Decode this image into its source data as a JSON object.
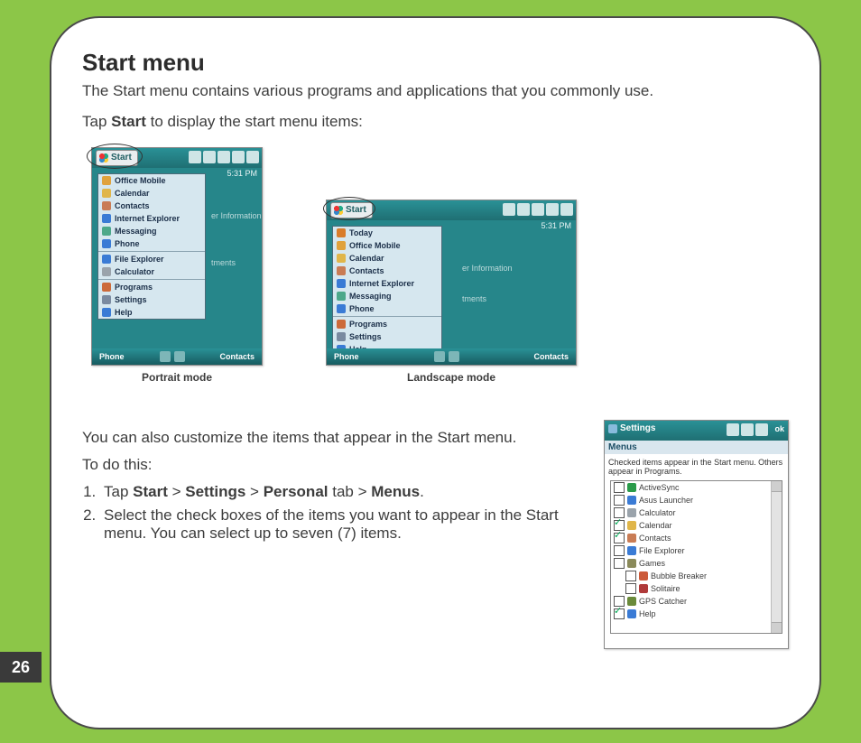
{
  "page_number": "26",
  "heading": "Start menu",
  "intro": "The Start menu contains various programs and applications that you commonly use.",
  "tap_pre": "Tap ",
  "tap_bold": "Start",
  "tap_post": " to display the start menu items:",
  "caption_portrait": "Portrait mode",
  "caption_landscape": "Landscape mode",
  "start_label": "Start",
  "clock": "5:31 PM",
  "bg1": "er Information",
  "bg2": "tments",
  "menu_portrait": [
    {
      "label": "Office Mobile",
      "color": "#e0a23c",
      "bold": true,
      "sep": false
    },
    {
      "label": "Calendar",
      "color": "#e0b64a",
      "bold": true,
      "sep": false
    },
    {
      "label": "Contacts",
      "color": "#c97c55",
      "bold": true,
      "sep": false
    },
    {
      "label": "Internet Explorer",
      "color": "#3a7bd5",
      "bold": true,
      "sep": false
    },
    {
      "label": "Messaging",
      "color": "#4ca88a",
      "bold": true,
      "sep": false
    },
    {
      "label": "Phone",
      "color": "#3a7bd5",
      "bold": true,
      "sep": true
    },
    {
      "label": "File Explorer",
      "color": "#3a7bd5",
      "bold": true,
      "sep": false
    },
    {
      "label": "Calculator",
      "color": "#9aa3ab",
      "bold": true,
      "sep": true
    },
    {
      "label": "Programs",
      "color": "#cc6a3a",
      "bold": true,
      "sep": false
    },
    {
      "label": "Settings",
      "color": "#7a8aa0",
      "bold": true,
      "sep": false
    },
    {
      "label": "Help",
      "color": "#3a7bd5",
      "bold": true,
      "sep": false
    }
  ],
  "menu_landscape": [
    {
      "label": "Today",
      "color": "#d97c2a",
      "bold": true,
      "sep": false
    },
    {
      "label": "Office Mobile",
      "color": "#e0a23c",
      "bold": true,
      "sep": false
    },
    {
      "label": "Calendar",
      "color": "#e0b64a",
      "bold": true,
      "sep": false
    },
    {
      "label": "Contacts",
      "color": "#c97c55",
      "bold": true,
      "sep": false
    },
    {
      "label": "Internet Explorer",
      "color": "#3a7bd5",
      "bold": true,
      "sep": false
    },
    {
      "label": "Messaging",
      "color": "#4ca88a",
      "bold": true,
      "sep": false
    },
    {
      "label": "Phone",
      "color": "#3a7bd5",
      "bold": true,
      "sep": true
    },
    {
      "label": "Programs",
      "color": "#cc6a3a",
      "bold": true,
      "sep": false
    },
    {
      "label": "Settings",
      "color": "#7a8aa0",
      "bold": true,
      "sep": false
    },
    {
      "label": "Help",
      "color": "#3a7bd5",
      "bold": true,
      "sep": false
    }
  ],
  "soft_left": "Phone",
  "soft_right": "Contacts",
  "customize_line": "You can also customize the items that appear in the Start menu.",
  "to_do": "To do this:",
  "step1": {
    "pre": "Tap ",
    "b1": "Start",
    "t1": " > ",
    "b2": "Settings",
    "t2": " > ",
    "b3": "Personal",
    "t3": " tab > ",
    "b4": "Menus",
    "t4": "."
  },
  "step2": "Select the check boxes of the items you want to appear in the Start menu. You can select up to seven (7) items.",
  "settings": {
    "title": "Settings",
    "ok": "ok",
    "section": "Menus",
    "desc": "Checked items appear in the Start menu. Others appear in Programs.",
    "items": [
      {
        "label": "ActiveSync",
        "checked": false,
        "indent": false,
        "color": "#2a9b4a"
      },
      {
        "label": "Asus Launcher",
        "checked": false,
        "indent": false,
        "color": "#3a7bd5"
      },
      {
        "label": "Calculator",
        "checked": false,
        "indent": false,
        "color": "#9aa3ab"
      },
      {
        "label": "Calendar",
        "checked": true,
        "indent": false,
        "color": "#e0b64a"
      },
      {
        "label": "Contacts",
        "checked": true,
        "indent": false,
        "color": "#c97c55"
      },
      {
        "label": "File Explorer",
        "checked": false,
        "indent": false,
        "color": "#3a7bd5"
      },
      {
        "label": "Games",
        "checked": false,
        "indent": false,
        "color": "#8a8a5a"
      },
      {
        "label": "Bubble Breaker",
        "checked": false,
        "indent": true,
        "color": "#cc5a3a"
      },
      {
        "label": "Solitaire",
        "checked": false,
        "indent": true,
        "color": "#b03a3a"
      },
      {
        "label": "GPS Catcher",
        "checked": false,
        "indent": false,
        "color": "#6a8a3a"
      },
      {
        "label": "Help",
        "checked": true,
        "indent": false,
        "color": "#3a7bd5"
      }
    ]
  }
}
